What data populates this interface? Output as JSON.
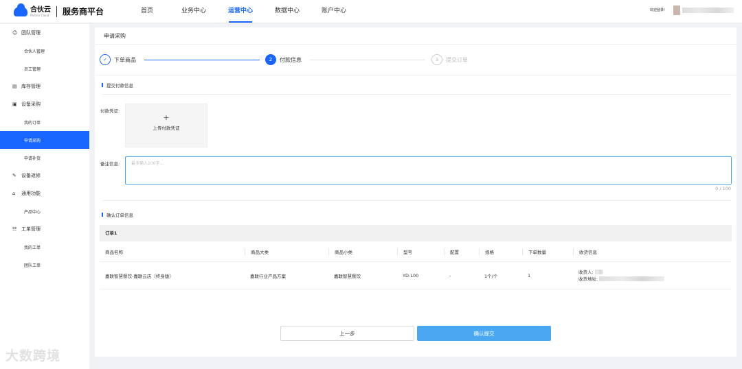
{
  "header": {
    "brand_name": "合伙云",
    "brand_sub": "Partner Cloud",
    "platform": "服务商平台",
    "nav": [
      "首页",
      "业务中心",
      "运营中心",
      "数据中心",
      "账户中心"
    ],
    "active_nav": "运营中心",
    "welcome": "欢迎登录!"
  },
  "sidebar": {
    "items": [
      {
        "type": "group",
        "label": "团队管理",
        "icon": "team-icon"
      },
      {
        "type": "sub",
        "label": "合伙人管理"
      },
      {
        "type": "sub",
        "label": "员工管理"
      },
      {
        "type": "group",
        "label": "库存管理",
        "icon": "inventory-icon"
      },
      {
        "type": "group",
        "label": "设备采购",
        "icon": "purchase-icon"
      },
      {
        "type": "sub",
        "label": "我的订单"
      },
      {
        "type": "sub",
        "label": "申请采购",
        "active": true
      },
      {
        "type": "sub",
        "label": "申请补货"
      },
      {
        "type": "group",
        "label": "设备返修",
        "icon": "repair-icon"
      },
      {
        "type": "group",
        "label": "通用功能",
        "icon": "home-icon"
      },
      {
        "type": "sub",
        "label": "产品中心"
      },
      {
        "type": "group",
        "label": "工单管理",
        "icon": "ticket-icon"
      },
      {
        "type": "sub",
        "label": "我的工单"
      },
      {
        "type": "sub",
        "label": "团队工单"
      }
    ]
  },
  "main": {
    "title": "申请采购",
    "steps": [
      {
        "num": "✓",
        "label": "下单商品",
        "status": "done"
      },
      {
        "num": "2",
        "label": "付款信息",
        "status": "active"
      },
      {
        "num": "3",
        "label": "提交订单",
        "status": "pending"
      }
    ],
    "payment_section": "提交付款信息",
    "voucher_label": "付款凭证:",
    "upload_plus": "+",
    "upload_text": "上传付款凭证",
    "remark_label": "备注信息:",
    "remark_placeholder": "最多输入100字...",
    "remark_counter": "0 / 100",
    "order_section": "确认订单信息",
    "order_name": "订单1",
    "columns": [
      "商品名称",
      "商品大类",
      "商品小类",
      "型号",
      "配置",
      "规格",
      "下单数量",
      "收货信息"
    ],
    "row": [
      "嘉联智慧餐饮-嘉联云店（终身版）",
      "嘉联行业产品方案",
      "嘉联智慧餐饮",
      "YD-L00",
      "-",
      "1个/个",
      "1"
    ],
    "receiver_label": "收货人:",
    "address_label": "收货地址:",
    "prev_button": "上一步",
    "confirm_button": "确认提交"
  },
  "watermark": "大数跨境",
  "colors": {
    "accent": "#1966ff",
    "confirm": "#4aa8f2"
  }
}
